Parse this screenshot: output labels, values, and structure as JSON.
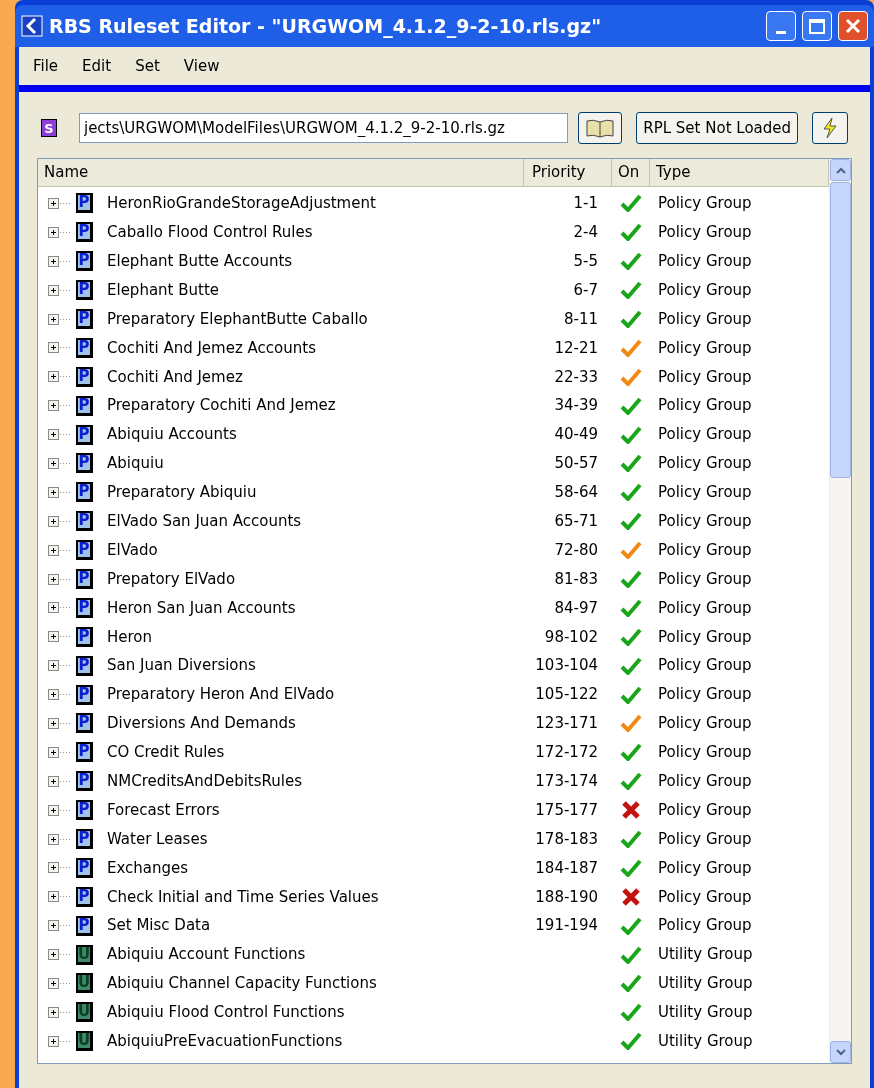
{
  "window": {
    "title": "RBS Ruleset Editor - \"URGWOM_4.1.2_9-2-10.rls.gz\""
  },
  "menu": [
    "File",
    "Edit",
    "Set",
    "View"
  ],
  "toolbar": {
    "set_badge": "S",
    "path": "jects\\URGWOM\\ModelFiles\\URGWOM_4.1.2_9-2-10.rls.gz",
    "rpl_button": "RPL Set Not Loaded"
  },
  "table": {
    "columns": [
      "Name",
      "Priority",
      "On",
      "Type"
    ],
    "rows": [
      {
        "kind": "policy",
        "badge": "P",
        "name": "HeronRioGrandeStorageAdjustment",
        "priority": "1-1",
        "on": true,
        "partial": false,
        "type": "Policy Group"
      },
      {
        "kind": "policy",
        "badge": "P",
        "name": "Caballo Flood Control Rules",
        "priority": "2-4",
        "on": true,
        "partial": false,
        "type": "Policy Group"
      },
      {
        "kind": "policy",
        "badge": "P",
        "name": "Elephant Butte Accounts",
        "priority": "5-5",
        "on": true,
        "partial": false,
        "type": "Policy Group"
      },
      {
        "kind": "policy",
        "badge": "P",
        "name": "Elephant Butte",
        "priority": "6-7",
        "on": true,
        "partial": false,
        "type": "Policy Group"
      },
      {
        "kind": "policy",
        "badge": "P",
        "name": "Preparatory ElephantButte Caballo",
        "priority": "8-11",
        "on": true,
        "partial": false,
        "type": "Policy Group"
      },
      {
        "kind": "policy",
        "badge": "P",
        "name": "Cochiti And Jemez Accounts",
        "priority": "12-21",
        "on": true,
        "partial": true,
        "type": "Policy Group"
      },
      {
        "kind": "policy",
        "badge": "P",
        "name": "Cochiti And Jemez",
        "priority": "22-33",
        "on": true,
        "partial": true,
        "type": "Policy Group"
      },
      {
        "kind": "policy",
        "badge": "P",
        "name": "Preparatory Cochiti And Jemez",
        "priority": "34-39",
        "on": true,
        "partial": false,
        "type": "Policy Group"
      },
      {
        "kind": "policy",
        "badge": "P",
        "name": "Abiquiu Accounts",
        "priority": "40-49",
        "on": true,
        "partial": false,
        "type": "Policy Group"
      },
      {
        "kind": "policy",
        "badge": "P",
        "name": "Abiquiu",
        "priority": "50-57",
        "on": true,
        "partial": false,
        "type": "Policy Group"
      },
      {
        "kind": "policy",
        "badge": "P",
        "name": "Preparatory Abiquiu",
        "priority": "58-64",
        "on": true,
        "partial": false,
        "type": "Policy Group"
      },
      {
        "kind": "policy",
        "badge": "P",
        "name": "ElVado San Juan Accounts",
        "priority": "65-71",
        "on": true,
        "partial": false,
        "type": "Policy Group"
      },
      {
        "kind": "policy",
        "badge": "P",
        "name": "ElVado",
        "priority": "72-80",
        "on": true,
        "partial": true,
        "type": "Policy Group"
      },
      {
        "kind": "policy",
        "badge": "P",
        "name": "Prepatory ElVado",
        "priority": "81-83",
        "on": true,
        "partial": false,
        "type": "Policy Group"
      },
      {
        "kind": "policy",
        "badge": "P",
        "name": "Heron San Juan Accounts",
        "priority": "84-97",
        "on": true,
        "partial": false,
        "type": "Policy Group"
      },
      {
        "kind": "policy",
        "badge": "P",
        "name": "Heron",
        "priority": "98-102",
        "on": true,
        "partial": false,
        "type": "Policy Group"
      },
      {
        "kind": "policy",
        "badge": "P",
        "name": "San Juan Diversions",
        "priority": "103-104",
        "on": true,
        "partial": false,
        "type": "Policy Group"
      },
      {
        "kind": "policy",
        "badge": "P",
        "name": "Preparatory Heron And ElVado",
        "priority": "105-122",
        "on": true,
        "partial": false,
        "type": "Policy Group"
      },
      {
        "kind": "policy",
        "badge": "P",
        "name": "Diversions And Demands",
        "priority": "123-171",
        "on": true,
        "partial": true,
        "type": "Policy Group"
      },
      {
        "kind": "policy",
        "badge": "P",
        "name": "CO Credit Rules",
        "priority": "172-172",
        "on": true,
        "partial": false,
        "type": "Policy Group"
      },
      {
        "kind": "policy",
        "badge": "P",
        "name": "NMCreditsAndDebitsRules",
        "priority": "173-174",
        "on": true,
        "partial": false,
        "type": "Policy Group"
      },
      {
        "kind": "policy",
        "badge": "P",
        "name": "Forecast Errors",
        "priority": "175-177",
        "on": false,
        "partial": false,
        "type": "Policy Group"
      },
      {
        "kind": "policy",
        "badge": "P",
        "name": "Water Leases",
        "priority": "178-183",
        "on": true,
        "partial": false,
        "type": "Policy Group"
      },
      {
        "kind": "policy",
        "badge": "P",
        "name": "Exchanges",
        "priority": "184-187",
        "on": true,
        "partial": false,
        "type": "Policy Group"
      },
      {
        "kind": "policy",
        "badge": "P",
        "name": "Check Initial and Time Series Values",
        "priority": "188-190",
        "on": false,
        "partial": false,
        "type": "Policy Group"
      },
      {
        "kind": "policy",
        "badge": "P",
        "name": "Set Misc Data",
        "priority": "191-194",
        "on": true,
        "partial": false,
        "type": "Policy Group"
      },
      {
        "kind": "utility",
        "badge": "U",
        "name": "Abiquiu Account Functions",
        "on": true,
        "partial": false,
        "type": "Utility Group"
      },
      {
        "kind": "utility",
        "badge": "U",
        "name": "Abiquiu Channel Capacity Functions",
        "on": true,
        "partial": false,
        "type": "Utility Group"
      },
      {
        "kind": "utility",
        "badge": "U",
        "name": "Abiquiu Flood Control Functions",
        "on": true,
        "partial": false,
        "type": "Utility Group"
      },
      {
        "kind": "utility",
        "badge": "U",
        "name": "AbiquiuPreEvacuationFunctions",
        "on": true,
        "partial": false,
        "type": "Utility Group"
      }
    ]
  }
}
